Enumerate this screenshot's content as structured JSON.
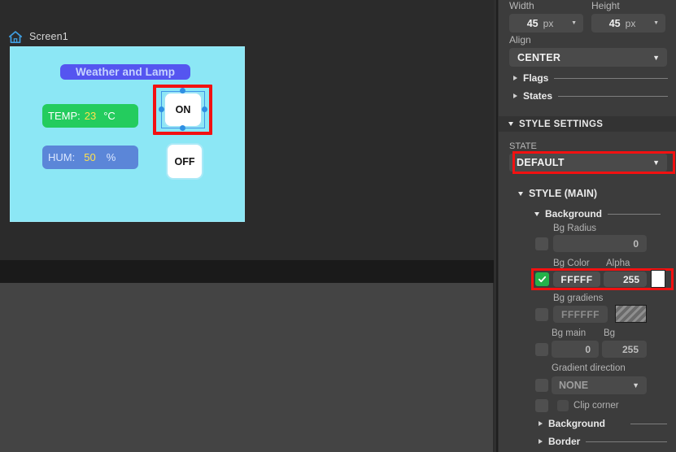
{
  "editor": {
    "screen_tab": {
      "label": "Screen1",
      "icon": "home-icon"
    },
    "canvas": {
      "title_widget": {
        "text": "Weather and Lamp"
      },
      "temp_widget": {
        "label": "TEMP:",
        "value": "23",
        "unit": "°C"
      },
      "hum_widget": {
        "label": "HUM:",
        "value": "50",
        "unit": "%"
      },
      "on_button": {
        "label": "ON"
      },
      "off_button": {
        "label": "OFF"
      }
    }
  },
  "properties": {
    "width": {
      "label": "Width",
      "value": "45",
      "unit": "px",
      "caret": "▼"
    },
    "height": {
      "label": "Height",
      "value": "45",
      "unit": "px",
      "caret": "▼"
    },
    "align": {
      "label": "Align",
      "value": "CENTER",
      "caret": "▼"
    },
    "flags": {
      "label": "Flags"
    },
    "states": {
      "label": "States"
    },
    "style_settings": {
      "label": "STYLE SETTINGS"
    },
    "state": {
      "label": "STATE",
      "value": "DEFAULT",
      "caret": "▼"
    },
    "style_main": {
      "label": "STYLE (MAIN)"
    },
    "background_group": {
      "label": "Background"
    },
    "bg_radius": {
      "label": "Bg Radius",
      "value": "0"
    },
    "bg_color": {
      "label": "Bg Color",
      "value": "FFFFF",
      "checked": true,
      "swatch": "#FFFFFF"
    },
    "alpha": {
      "label": "Alpha",
      "value": "255"
    },
    "bg_gradiens": {
      "label": "Bg gradiens",
      "value": "FFFFFF"
    },
    "bg_main": {
      "label": "Bg main",
      "value": "0"
    },
    "bg_secondary": {
      "label": "Bg",
      "value": "255"
    },
    "gradient_direction": {
      "label": "Gradient direction",
      "value": "NONE",
      "caret": "▼"
    },
    "clip_corner": {
      "label": "Clip corner"
    },
    "background_section": {
      "label": "Background"
    },
    "border_section": {
      "label": "Border"
    }
  },
  "colors": {
    "panel_bg": "#3c3c3c",
    "editor_bg": "#2b2b2b",
    "canvas_bg": "#8ce7f5",
    "highlight_red": "#f21111",
    "accent_green": "#24b24a",
    "selection_blue": "#2f8fe3"
  }
}
